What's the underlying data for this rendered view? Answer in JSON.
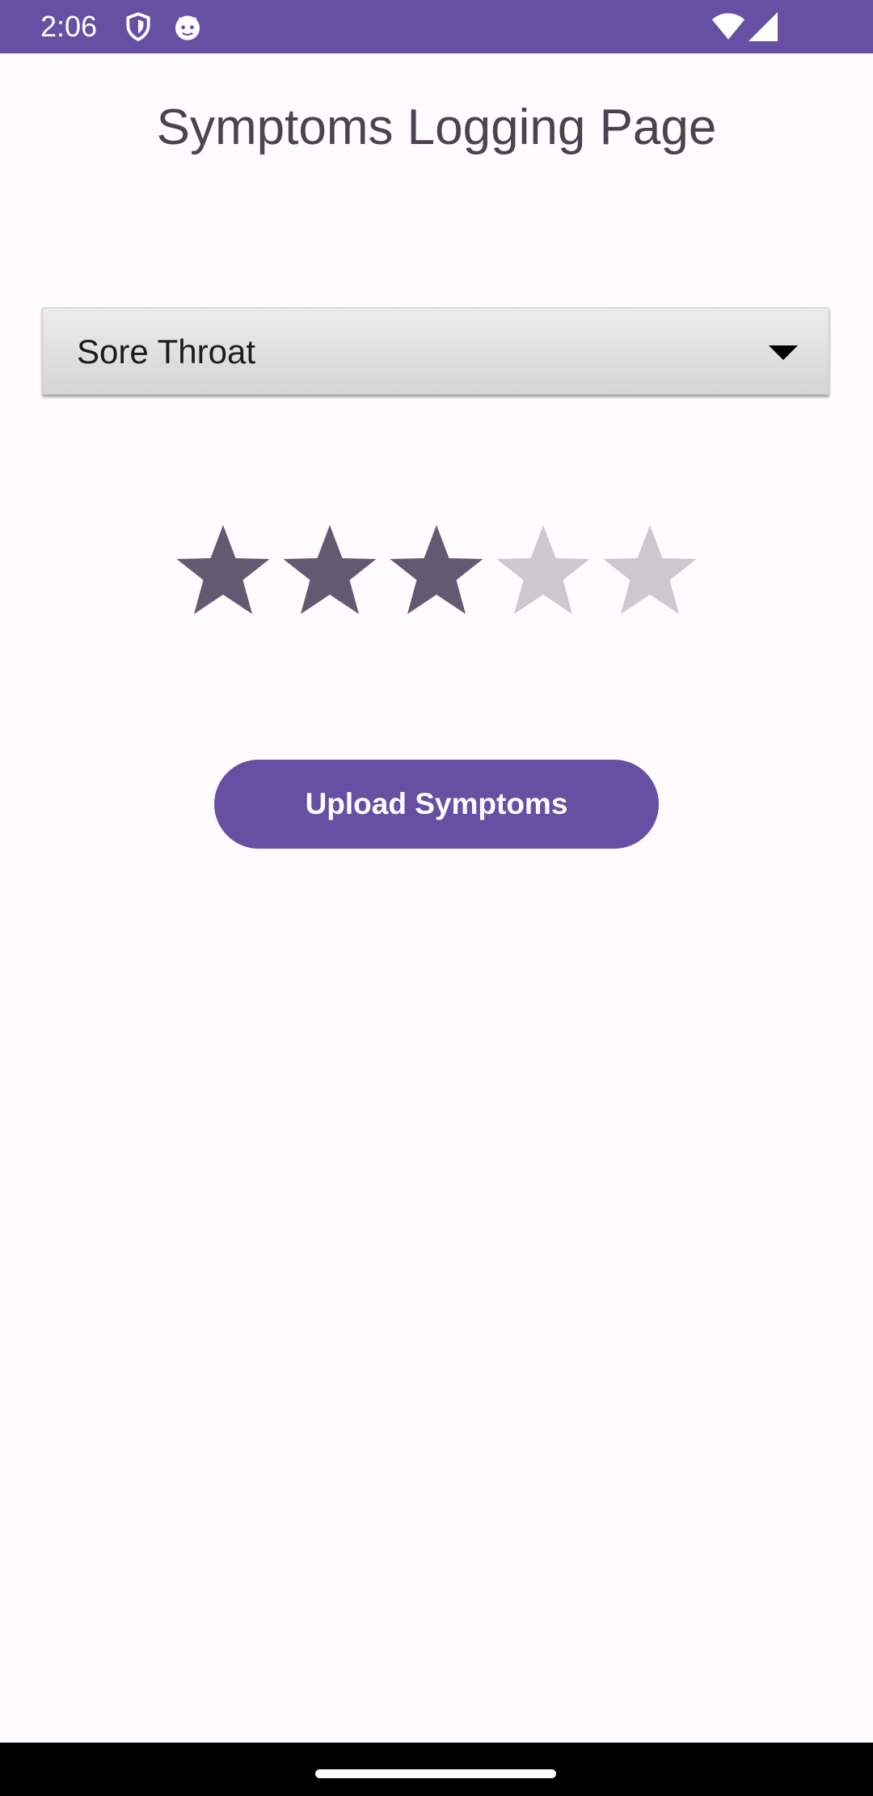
{
  "status_bar": {
    "time": "2:06",
    "icons": [
      "shield-icon",
      "android-robot-icon",
      "wifi-icon",
      "cell-signal-icon"
    ]
  },
  "page": {
    "title": "Symptoms Logging Page"
  },
  "symptom_spinner": {
    "selected_value": "Sore Throat"
  },
  "severity_rating": {
    "value": 3,
    "max": 5,
    "filled_color": "#615a70",
    "empty_color": "#cdc8ce"
  },
  "upload_button": {
    "label": "Upload Symptoms"
  },
  "colors": {
    "primary": "#6750a4",
    "background": "#fffbfe",
    "title_text": "#49454f"
  }
}
